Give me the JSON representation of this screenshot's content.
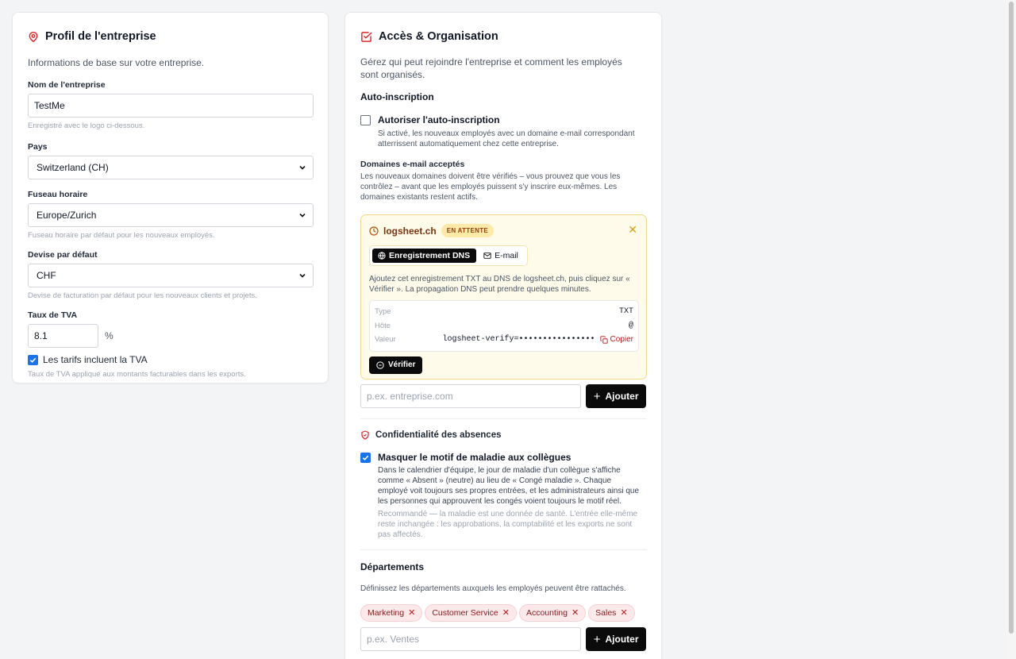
{
  "colors": {
    "accent_red": "#dc2626",
    "checkbox_blue": "#1a73e8",
    "pending_bg": "#fffbeb",
    "pending_border": "#f5d985"
  },
  "profile": {
    "title": "Profil de l'entreprise",
    "icon": "map-pin-icon",
    "description": "Informations de base sur votre entreprise.",
    "name_label": "Nom de l'entreprise",
    "name_value": "TestMe",
    "name_hint": "Enregistré avec le logo ci-dessous.",
    "country_label": "Pays",
    "country_value": "Switzerland (CH)",
    "timezone_label": "Fuseau horaire",
    "timezone_value": "Europe/Zurich",
    "timezone_hint": "Fuseau horaire par défaut pour les nouveaux employés.",
    "currency_label": "Devise par défaut",
    "currency_value": "CHF",
    "currency_hint": "Devise de facturation par défaut pour les nouveaux clients et projets.",
    "vat_label": "Taux de TVA",
    "vat_value": "8.1",
    "vat_unit": "%",
    "vat_inclusive_label": "Les tarifs incluent la TVA",
    "vat_inclusive_checked": true,
    "vat_hint": "Taux de TVA appliqué aux montants facturables dans les exports."
  },
  "access": {
    "title": "Accès & Organisation",
    "icon": "checkbox-square-icon",
    "description": "Gérez qui peut rejoindre l'entreprise et comment les employés sont organisés.",
    "self_signup_heading": "Auto-inscription",
    "self_signup_label": "Autoriser l'auto-inscription",
    "self_signup_checked": false,
    "self_signup_desc": "Si activé, les nouveaux employés avec un domaine e-mail correspondant atterrissent automatiquement chez cette entreprise.",
    "domains_heading": "Domaines e-mail acceptés",
    "domains_desc": "Les nouveaux domaines doivent être vérifiés – vous prouvez que vous les contrôlez – avant que les employés puissent s'y inscrire eux-mêmes. Les domaines existants restent actifs.",
    "pending": {
      "domain": "logsheet.ch",
      "status": "EN ATTENTE",
      "tab_dns": "Enregistrement DNS",
      "tab_email": "E-mail",
      "instructions": "Ajoutez cet enregistrement TXT au DNS de logsheet.ch, puis cliquez sur « Vérifier ». La propagation DNS peut prendre quelques minutes.",
      "record": [
        {
          "key": "Type",
          "value": "TXT"
        },
        {
          "key": "Hôte",
          "value": "@"
        },
        {
          "key": "Valeur",
          "value": "logsheet-verify=••••••••••••••••"
        }
      ],
      "copy_label": "Copier",
      "verify_label": "Vérifier"
    },
    "domain_input_placeholder": "p.ex. entreprise.com",
    "add_label": "Ajouter",
    "privacy_heading": "Confidentialité des absences",
    "privacy_label": "Masquer le motif de maladie aux collègues",
    "privacy_checked": true,
    "privacy_desc": "Dans le calendrier d'équipe, le jour de maladie d'un collègue s'affiche comme « Absent » (neutre) au lieu de « Congé maladie ». Chaque employé voit toujours ses propres entrées, et les administrateurs ainsi que les personnes qui approuvent les congés voient toujours le motif réel.",
    "privacy_note": "Recommandé — la maladie est une donnée de santé. L'entrée elle-même reste inchangée : les approbations, la comptabilité et les exports ne sont pas affectés.",
    "departments_heading": "Départements",
    "departments_desc": "Définissez les départements auxquels les employés peuvent être rattachés.",
    "departments": [
      "Marketing",
      "Customer Service",
      "Accounting",
      "Sales"
    ],
    "department_input_placeholder": "p.ex. Ventes",
    "department_add_label": "Ajouter"
  }
}
